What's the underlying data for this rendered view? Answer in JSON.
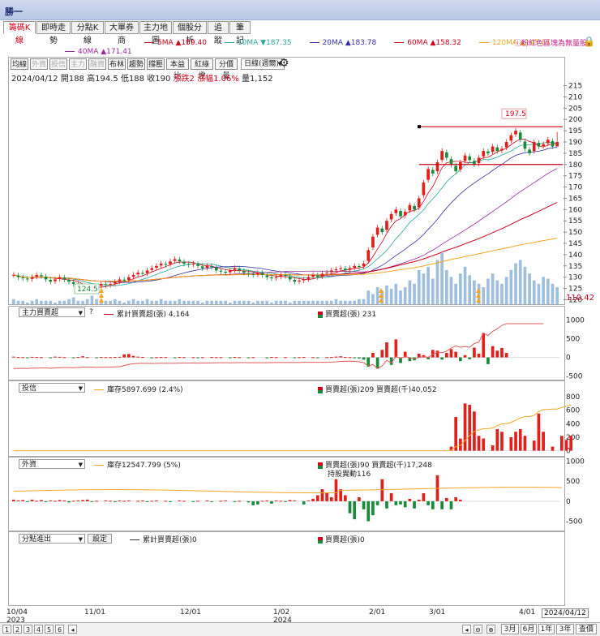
{
  "window": {
    "title": "勝一"
  },
  "tabs": [
    "籌碼K線",
    "即時走勢",
    "分點K線",
    "大單券商",
    "主力地圖",
    "個股分析",
    "追蹤",
    "筆記"
  ],
  "ma_legend": {
    "row1": [
      {
        "label": "5MA ▲189.40",
        "color": "#d0021b"
      },
      {
        "label": "10MA ▼187.35",
        "color": "#2aa79b"
      },
      {
        "label": "20MA ▲183.78",
        "color": "#3a2fa8"
      },
      {
        "label": "60MA ▲158.32",
        "color": "#d0021b"
      },
      {
        "label": "120MA ▲145.51",
        "color": "#f5a623"
      }
    ],
    "row2": [
      {
        "label": "40MA ▲171.41",
        "color": "#9b2aa0"
      }
    ],
    "hint": "粉紅色區塊為無量股"
  },
  "toolbar": {
    "buttons": [
      "均線",
      "外資",
      "投信",
      "主力",
      "融資",
      "布林",
      "趨勢",
      "撐壓",
      "本益比",
      "紅綠燈",
      "分價量"
    ],
    "dim": [
      false,
      true,
      true,
      true,
      true,
      false,
      false,
      false,
      false,
      false,
      false
    ],
    "period": "日線(週爾)"
  },
  "info": {
    "date": "2024/04/12",
    "open_label": "開",
    "open": "188",
    "high_label": "高",
    "high": "194.5",
    "low_label": "低",
    "low": "188",
    "close_label": "收",
    "close": "190",
    "change_label": "漲跌",
    "change": "2",
    "pct_label": "漲幅",
    "pct": "1.06%",
    "vol_label": "量",
    "vol": "1,152"
  },
  "price_axis": {
    "ticks": [
      215,
      210,
      205,
      200,
      195,
      190,
      185,
      180,
      175,
      170,
      165,
      160,
      155,
      150,
      145,
      140,
      135,
      130,
      125,
      120
    ],
    "current": "110.42"
  },
  "price_annotations": {
    "high": "197.5",
    "low": "124.5"
  },
  "panels": {
    "main_force": {
      "select": "主力買賣超",
      "q": "?",
      "legend1": "累計買賣超(張) 4,164",
      "legend2": "買賣超(張) 231",
      "ticks": [
        "1000",
        "500",
        "0",
        "-500"
      ]
    },
    "trust": {
      "select": "投信",
      "legend1": "庫存5897.699 (2.4%)",
      "legend2": "買賣超(張)209 買賣超(千)40,052",
      "ticks": [
        "800",
        "600",
        "400",
        "200",
        "0"
      ]
    },
    "foreign": {
      "select": "外資",
      "legend1": "庫存12547.799 (5%)",
      "legend2": "買賣超(張)90 買賣超(千)17,248",
      "legend3": "持股異動116",
      "ticks": [
        "1000",
        "500",
        "0",
        "-500"
      ]
    },
    "branch": {
      "select": "分點進出",
      "button": "設定",
      "legend1": "累計買賣超(張)0",
      "legend2": "買賣超(張)0"
    }
  },
  "x_axis": [
    {
      "label": "10/04",
      "sub": "2023"
    },
    {
      "label": "11/01",
      "sub": ""
    },
    {
      "label": "12/01",
      "sub": ""
    },
    {
      "label": "1/02",
      "sub": "2024"
    },
    {
      "label": "2/01",
      "sub": ""
    },
    {
      "label": "3/01",
      "sub": ""
    },
    {
      "label": "4/01",
      "sub": ""
    },
    {
      "label": "2024/04/12",
      "sub": ""
    }
  ],
  "bottom": {
    "pages": [
      "1",
      "2",
      "3",
      "4",
      "5",
      "6"
    ],
    "ranges": [
      "3月",
      "6月",
      "1年",
      "3年",
      "查價"
    ]
  },
  "colors": {
    "up": "#e0201b",
    "down": "#1a8a3a",
    "volume": "#9fbfdd",
    "accent": "#d0021b"
  },
  "chart_data": {
    "type": "candlestick",
    "dates": [
      "2023/10/04",
      "2024/04/12"
    ],
    "last_bar": {
      "open": 188,
      "high": 194.5,
      "low": 188,
      "close": 190
    },
    "ylim": [
      118,
      217
    ],
    "highest": 197.5,
    "lowest": 124.5,
    "closes": [
      131,
      130,
      129.5,
      129,
      130,
      131,
      130.5,
      129,
      128,
      129,
      130,
      129,
      128,
      127,
      126,
      125.5,
      125,
      124.5,
      126,
      127,
      126.5,
      127,
      128,
      129,
      128.5,
      130,
      131,
      132,
      131.5,
      133,
      134,
      135,
      136,
      135.5,
      137,
      138,
      137,
      136,
      135.5,
      136,
      135,
      134,
      135,
      134.5,
      133,
      132.5,
      132,
      133,
      134,
      133,
      132,
      131.5,
      131,
      132,
      131,
      130,
      129.5,
      130,
      131,
      130.5,
      129,
      128,
      128.5,
      129,
      130,
      131,
      130,
      131.5,
      132,
      133,
      133.5,
      134,
      133,
      134,
      135,
      134.5,
      136,
      142,
      148,
      152,
      150,
      155,
      158,
      160,
      157,
      159,
      162,
      160,
      165,
      172,
      178,
      176,
      181,
      186,
      183,
      180,
      177,
      181,
      184,
      182,
      180,
      183,
      186,
      185,
      188,
      186,
      187,
      190,
      193,
      195,
      191,
      187,
      185,
      190,
      188,
      189,
      191,
      188,
      190
    ],
    "volume_rel": [
      3,
      2,
      2,
      1,
      2,
      3,
      2,
      2,
      2,
      1,
      2,
      2,
      3,
      4,
      2,
      2,
      3,
      5,
      3,
      2,
      2,
      2,
      3,
      2,
      1,
      2,
      3,
      2,
      2,
      3,
      2,
      2,
      3,
      2,
      2,
      2,
      3,
      2,
      2,
      2,
      2,
      1,
      2,
      2,
      2,
      2,
      2,
      1,
      2,
      2,
      2,
      2,
      1,
      2,
      2,
      2,
      1,
      2,
      2,
      2,
      1,
      2,
      2,
      2,
      2,
      2,
      2,
      2,
      2,
      2,
      3,
      2,
      2,
      2,
      2,
      3,
      3,
      8,
      6,
      10,
      8,
      11,
      9,
      12,
      8,
      10,
      14,
      12,
      20,
      18,
      22,
      15,
      26,
      30,
      20,
      16,
      12,
      18,
      22,
      17,
      14,
      12,
      10,
      15,
      18,
      14,
      12,
      16,
      20,
      24,
      26,
      22,
      18,
      14,
      12,
      16,
      15,
      12,
      10
    ],
    "main_force": [
      20,
      10,
      5,
      -5,
      15,
      10,
      5,
      0,
      -10,
      20,
      15,
      5,
      0,
      -5,
      10,
      30,
      5,
      0,
      -20,
      10,
      5,
      5,
      10,
      15,
      80,
      90,
      40,
      20,
      10,
      0,
      -10,
      5,
      10,
      5,
      0,
      -5,
      10,
      5,
      0,
      5,
      -10,
      5,
      0,
      10,
      5,
      5,
      0,
      -5,
      10,
      5,
      0,
      -10,
      5,
      0,
      0,
      -5,
      10,
      5,
      0,
      5,
      0,
      -5,
      5,
      10,
      0,
      5,
      -5,
      0,
      5,
      10,
      20,
      30,
      10,
      5,
      -10,
      -30,
      -60,
      -250,
      120,
      -300,
      200,
      400,
      -200,
      480,
      -150,
      150,
      -100,
      -80,
      100,
      60,
      -50,
      200,
      180,
      -60,
      120,
      220,
      150,
      -100,
      60,
      -50,
      260,
      100,
      650,
      -180,
      300,
      180,
      250,
      120,
      0,
      0,
      0,
      0,
      0,
      0,
      0,
      0
    ],
    "trust": [
      0,
      0,
      0,
      0,
      0,
      0,
      0,
      0,
      0,
      0,
      0,
      0,
      0,
      0,
      0,
      0,
      0,
      0,
      0,
      0,
      0,
      0,
      0,
      0,
      0,
      0,
      0,
      0,
      0,
      0,
      0,
      0,
      0,
      0,
      0,
      0,
      0,
      0,
      0,
      0,
      0,
      0,
      0,
      0,
      0,
      0,
      0,
      0,
      0,
      0,
      0,
      0,
      0,
      0,
      0,
      0,
      0,
      0,
      0,
      0,
      0,
      0,
      0,
      0,
      0,
      0,
      0,
      0,
      0,
      0,
      0,
      0,
      0,
      0,
      0,
      0,
      0,
      0,
      0,
      0,
      0,
      0,
      0,
      0,
      0,
      0,
      0,
      0,
      0,
      0,
      0,
      0,
      0,
      0,
      0,
      60,
      500,
      180,
      700,
      680,
      580,
      220,
      180,
      0,
      80,
      320,
      280,
      0,
      200,
      280,
      320,
      220,
      0,
      150,
      550,
      280,
      0,
      60,
      0,
      220,
      160,
      220
    ],
    "foreign": [
      40,
      20,
      30,
      -20,
      40,
      10,
      30,
      -10,
      20,
      10,
      30,
      20,
      -30,
      10,
      20,
      30,
      40,
      -20,
      10,
      0,
      20,
      10,
      -10,
      20,
      10,
      20,
      0,
      10,
      20,
      -10,
      10,
      20,
      0,
      10,
      -10,
      0,
      20,
      10,
      0,
      -10,
      10,
      0,
      20,
      -10,
      0,
      10,
      20,
      0,
      -20,
      10,
      0,
      -30,
      -100,
      -80,
      10,
      20,
      -60,
      20,
      10,
      -20,
      30,
      20,
      0,
      -80,
      20,
      60,
      150,
      300,
      200,
      100,
      550,
      300,
      150,
      -300,
      -450,
      100,
      -200,
      -500,
      -350,
      -100,
      550,
      -180,
      200,
      -100,
      -80,
      -150,
      60,
      -180,
      40,
      200,
      -100,
      -200,
      650,
      -200,
      80,
      -200,
      100,
      40,
      0,
      0,
      0,
      0,
      0,
      0,
      0,
      0,
      0,
      0,
      0,
      0,
      0,
      0,
      0,
      0,
      0,
      0,
      0,
      0,
      0,
      0
    ]
  }
}
